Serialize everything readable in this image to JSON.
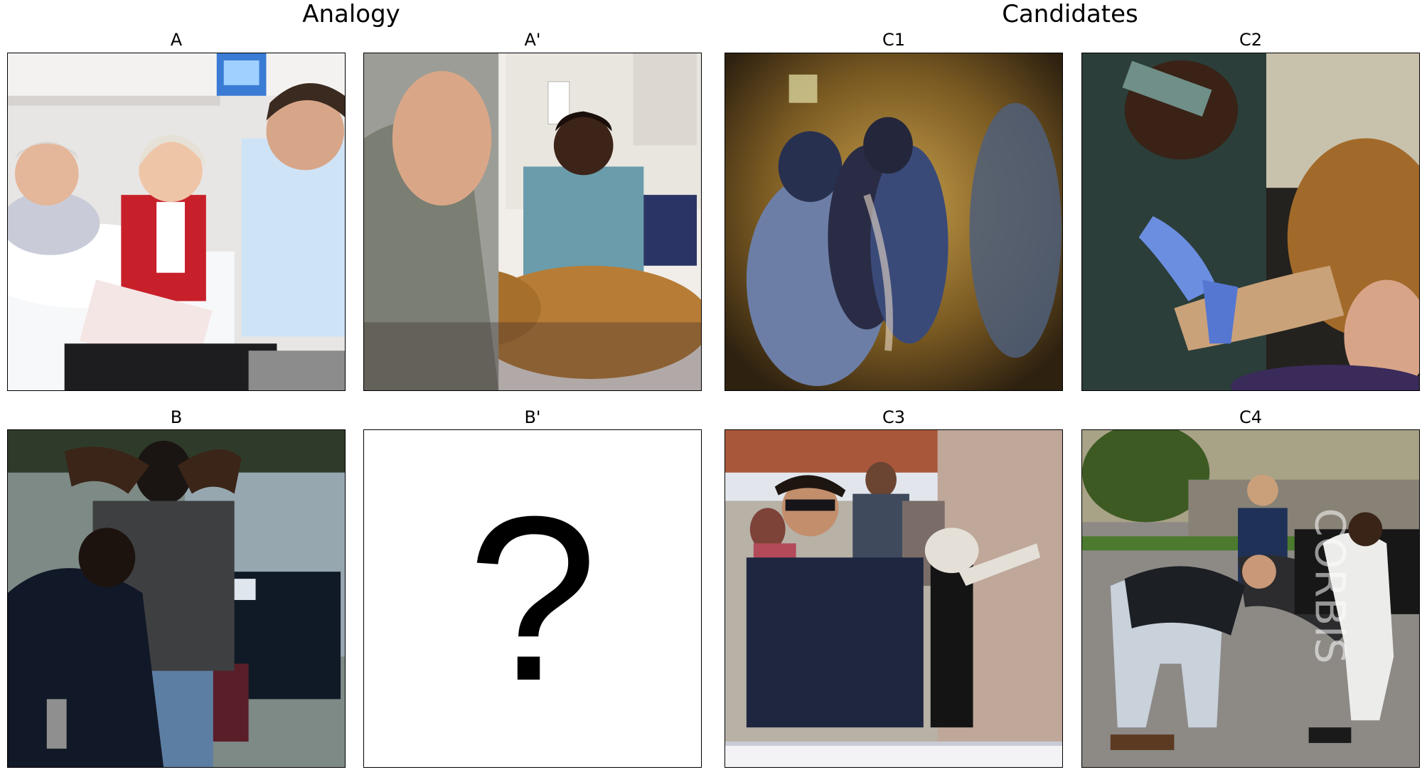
{
  "headers": {
    "analogy": "Analogy",
    "candidates": "Candidates"
  },
  "panels": [
    {
      "label": "A",
      "description": "Doctor in a blue shirt holding a clipboard talking with a smiling older man in a hospital bed and a smiling older woman in a red cardigan; IV monitor in background"
    },
    {
      "label": "A'",
      "description": "Veterinarian in scrubs with stethoscope examining a brown dog on a table while a soldier in camouflage watches"
    },
    {
      "label": "C1",
      "description": "Motion-blurred image of riot police in blue camouflage uniforms escorting a person"
    },
    {
      "label": "C2",
      "description": "Masked veterinarian in blue gloves treating the leg of a brown dog"
    },
    {
      "label": "B",
      "description": "Police officer frisking a man with his hands behind his head next to a police car"
    },
    {
      "label": "B'",
      "text": "?"
    },
    {
      "label": "C3",
      "description": "Police officer in sunglasses pretending to frisk a dog standing with its paws against a wall while onlookers take photos"
    },
    {
      "label": "C4",
      "description": "Police officer in a vest searching a handcuffed person leaning on a car, another officer behind",
      "watermark": "CORBIS"
    }
  ],
  "colors": {
    "background": "#ffffff",
    "border": "#000000",
    "text": "#000000"
  }
}
